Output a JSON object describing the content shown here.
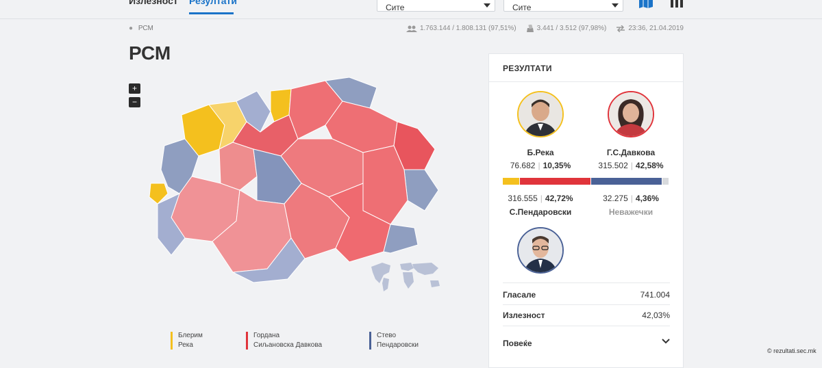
{
  "tabs": [
    {
      "label": "Излезност",
      "active": false
    },
    {
      "label": "Резултати",
      "active": true
    }
  ],
  "filters": {
    "select1_value": "Сите",
    "select2_value": "Сите"
  },
  "toolbar_icons": [
    "map-icon",
    "columns-icon"
  ],
  "location": "РСМ",
  "stats": {
    "voters": "1.763.144 / 1.808.131 (97,51%)",
    "stations": "3.441 / 3.512 (97,98%)",
    "updated": "23:36, 21.04.2019"
  },
  "page_title": "РСМ",
  "zoom": {
    "in": "+",
    "out": "−"
  },
  "legend": [
    {
      "name_line1": "Блерим",
      "name_line2": "Река",
      "color": "#f4c01e"
    },
    {
      "name_line1": "Гордана",
      "name_line2": "Сиљановска Давкова",
      "color": "#e0343b"
    },
    {
      "name_line1": "Стево",
      "name_line2": "Пендаровски",
      "color": "#4a6196"
    }
  ],
  "results": {
    "title": "РЕЗУЛТАТИ",
    "candidates": [
      {
        "name": "Б.Река",
        "votes": "76.682",
        "percent": "10,35%",
        "color": "#f4c01e"
      },
      {
        "name": "Г.С.Давкова",
        "votes": "315.502",
        "percent": "42,58%",
        "color": "#e0343b"
      },
      {
        "name": "С.Пендаровски",
        "votes": "316.555",
        "percent": "42,72%",
        "color": "#4a6196"
      }
    ],
    "invalid": {
      "label": "Неважечки",
      "votes": "32.275",
      "percent": "4,36%",
      "color": "#d8dadd"
    },
    "bar_shares": [
      10.35,
      42.58,
      42.72,
      4.36
    ],
    "voted_label": "Гласале",
    "voted_value": "741.004",
    "turnout_label": "Излезност",
    "turnout_value": "42,03%",
    "more_label": "Повеќе"
  },
  "credit": "© rezultati.sec.mk"
}
